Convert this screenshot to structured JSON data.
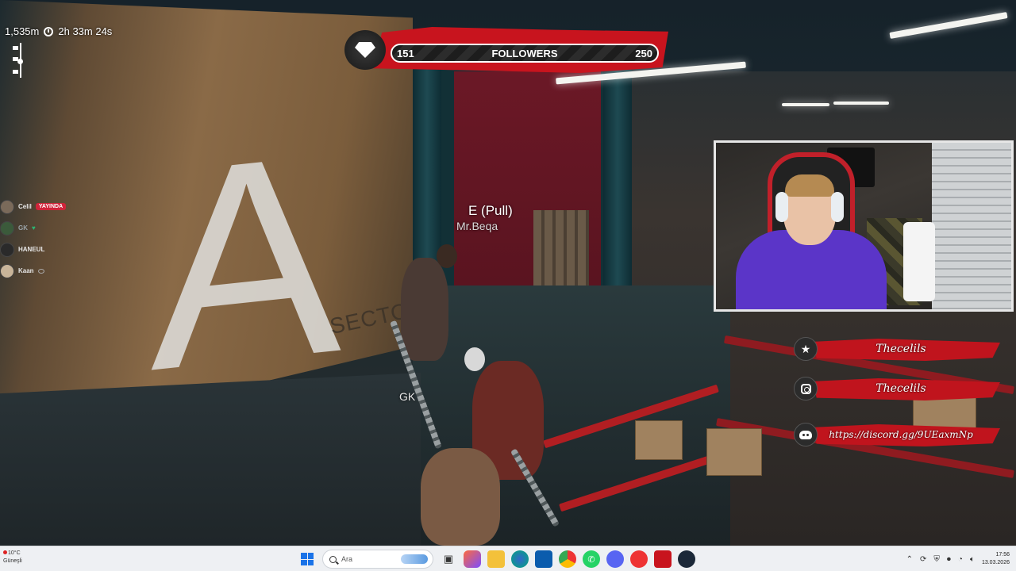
{
  "hud": {
    "distance": "1,535m",
    "elapsed_time": "2h 33m 24s"
  },
  "followers": {
    "title": "FOLLOWERS",
    "current": "151",
    "goal": "250",
    "progress": 0.0
  },
  "world_labels": {
    "interaction_prompt": "E (Pull)",
    "player_name": "Mr.Beqa",
    "teammate_name": "GK",
    "sector_sign_letter": "A",
    "sector_sign_text": "SECTO"
  },
  "voice_list": {
    "items": [
      {
        "name": "Celil",
        "badge": "YAYINDA",
        "status_icon": "live-badge"
      },
      {
        "name": "GK",
        "badge": "",
        "status_icon": "heart-icon"
      },
      {
        "name": "HANEUL",
        "badge": "",
        "status_icon": ""
      },
      {
        "name": "Kaan",
        "badge": "",
        "status_icon": "eye-icon"
      }
    ]
  },
  "socials": [
    {
      "icon": "star-icon",
      "text": "Thecelils"
    },
    {
      "icon": "instagram-icon",
      "text": "Thecelils"
    },
    {
      "icon": "discord-icon",
      "text": "https://discord.gg/9UEaxmNp"
    }
  ],
  "taskbar": {
    "weather_temp": "10°C",
    "weather_desc": "Güneşli",
    "search_placeholder": "Ara",
    "time": "17:56",
    "date": "13.03.2026"
  },
  "colors": {
    "accent_red": "#c8141e",
    "live_badge": "#d0243a",
    "taskbar_bg": "#eef0f3"
  }
}
